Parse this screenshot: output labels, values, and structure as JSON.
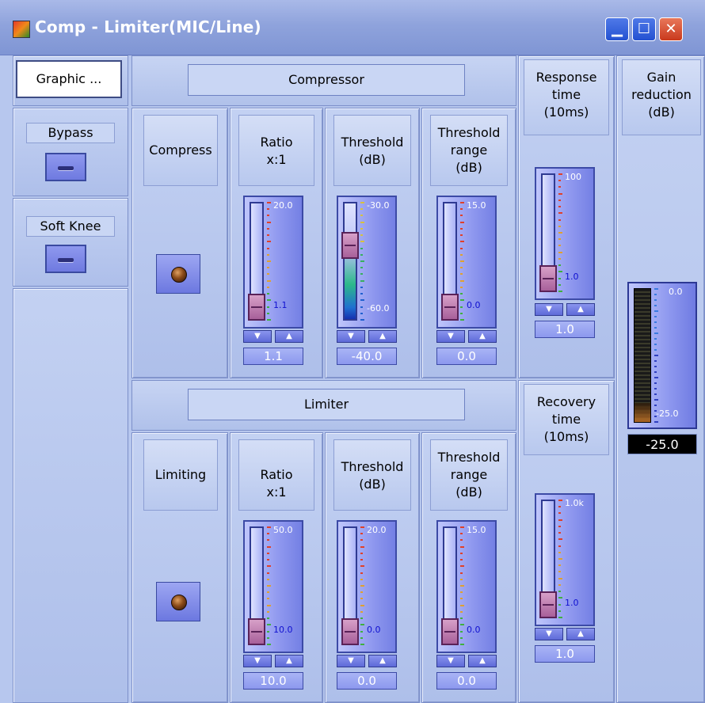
{
  "window": {
    "title": "Comp - Limiter(MIC/Line)",
    "min_label": "▁",
    "max_label": "☐",
    "close_label": "✕"
  },
  "left": {
    "graphic_label": "Graphic ...",
    "bypass_label": "Bypass",
    "soft_knee_label": "Soft Knee"
  },
  "compressor": {
    "title": "Compressor",
    "compress_label": "Compress",
    "ratio": {
      "label_line1": "Ratio",
      "label_line2": "x:1",
      "max": "20.0",
      "min": "1.1",
      "value": "1.1",
      "fraction": 0
    },
    "threshold": {
      "label_line1": "Threshold",
      "label_line2": "(dB)",
      "max": "-30.0",
      "min": "-60.0",
      "value": "-40.0",
      "fraction": 0.67
    },
    "range": {
      "label_line1": "Threshold",
      "label_line2": "range",
      "label_line3": "(dB)",
      "max": "15.0",
      "min": "0.0",
      "value": "0.0",
      "fraction": 0
    },
    "response": {
      "label_line1": "Response",
      "label_line2": "time",
      "label_line3": "(10ms)",
      "max": "100",
      "min": "1.0",
      "value": "1.0",
      "fraction": 0
    }
  },
  "limiter": {
    "title": "Limiter",
    "limiting_label": "Limiting",
    "ratio": {
      "label_line1": "Ratio",
      "label_line2": "x:1",
      "max": "50.0",
      "min": "10.0",
      "value": "10.0",
      "fraction": 0
    },
    "threshold": {
      "label_line1": "Threshold",
      "label_line2": "(dB)",
      "max": "20.0",
      "min": "0.0",
      "value": "0.0",
      "fraction": 0
    },
    "range": {
      "label_line1": "Threshold",
      "label_line2": "range",
      "label_line3": "(dB)",
      "max": "15.0",
      "min": "0.0",
      "value": "0.0",
      "fraction": 0
    },
    "recovery": {
      "label_line1": "Recovery",
      "label_line2": "time",
      "label_line3": "(10ms)",
      "max": "1.0k",
      "min": "1.0",
      "value": "1.0",
      "fraction": 0
    }
  },
  "gain": {
    "label_line1": "Gain",
    "label_line2": "reduction",
    "label_line3": "(dB)",
    "max": "0.0",
    "min": "-25.0",
    "value": "-25.0"
  },
  "step_labels": {
    "down": "▼",
    "up": "▲"
  },
  "colors": {
    "title_bar": "#8fa3dc",
    "panel": "#b7c7ee",
    "slider_face": "#8f98ef",
    "thumb": "#b870aa"
  }
}
